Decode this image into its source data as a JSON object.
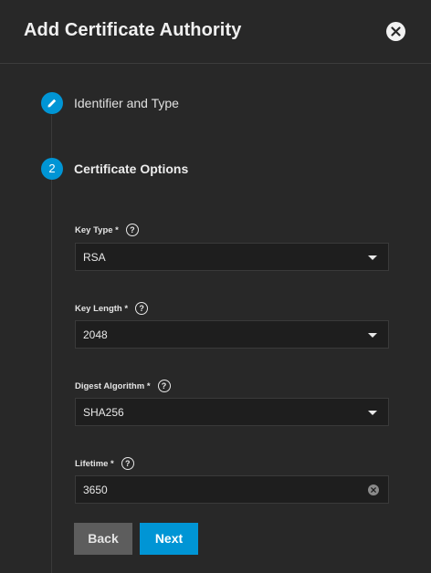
{
  "dialog": {
    "title": "Add Certificate Authority",
    "close_icon": "close-icon"
  },
  "steps": [
    {
      "marker_icon": "pencil-icon",
      "label": "Identifier and Type",
      "state": "completed"
    },
    {
      "marker": "2",
      "label": "Certificate Options",
      "state": "active"
    }
  ],
  "fields": {
    "key_type": {
      "label": "Key Type *",
      "value": "RSA",
      "help_icon": "help-icon"
    },
    "key_length": {
      "label": "Key Length *",
      "value": "2048",
      "help_icon": "help-icon"
    },
    "digest_algorithm": {
      "label": "Digest Algorithm *",
      "value": "SHA256",
      "help_icon": "help-icon"
    },
    "lifetime": {
      "label": "Lifetime *",
      "value": "3650",
      "help_icon": "help-icon",
      "clear_icon": "clear-icon"
    }
  },
  "buttons": {
    "back": "Back",
    "next": "Next"
  },
  "colors": {
    "accent": "#0095d5",
    "background": "#282828",
    "field_background": "#1e1e1e",
    "secondary_button": "#5d5d5d"
  }
}
